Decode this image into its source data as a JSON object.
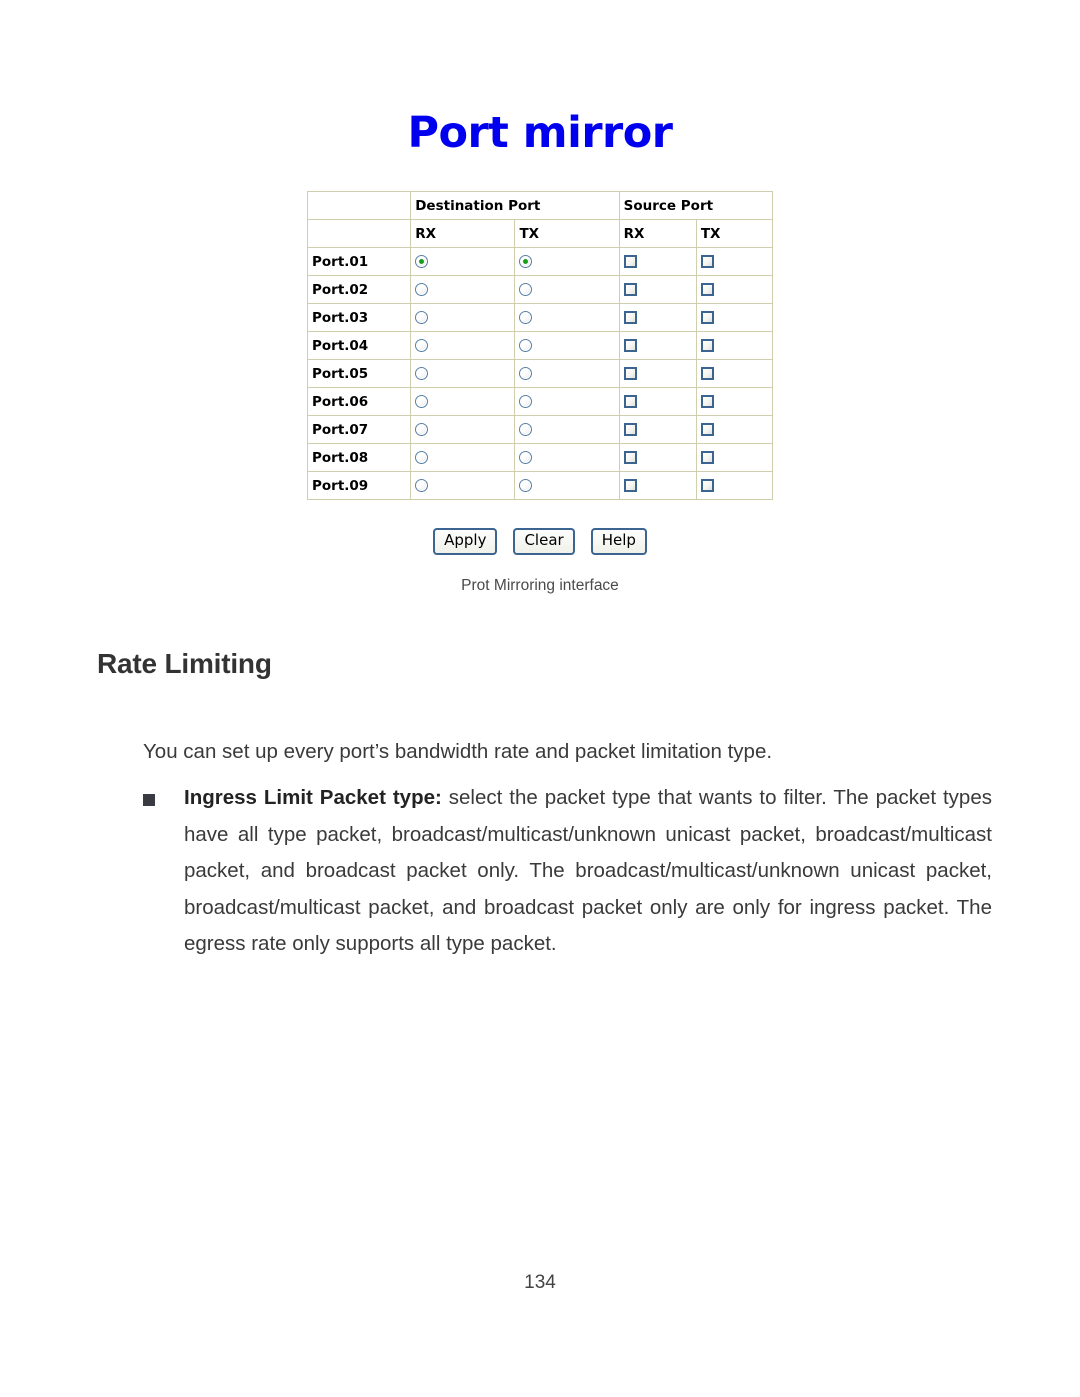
{
  "screenshot": {
    "title": "Port mirror",
    "title_color": "#0000ee",
    "table": {
      "group_headers": {
        "blank": "",
        "destination": "Destination Port",
        "source": "Source Port"
      },
      "sub_headers": {
        "dest_rx": "RX",
        "dest_tx": "TX",
        "src_rx": "RX",
        "src_tx": "TX"
      },
      "rows": [
        {
          "port": "Port.01",
          "dest_rx": true,
          "dest_tx": true,
          "src_rx": false,
          "src_tx": false
        },
        {
          "port": "Port.02",
          "dest_rx": false,
          "dest_tx": false,
          "src_rx": false,
          "src_tx": false
        },
        {
          "port": "Port.03",
          "dest_rx": false,
          "dest_tx": false,
          "src_rx": false,
          "src_tx": false
        },
        {
          "port": "Port.04",
          "dest_rx": false,
          "dest_tx": false,
          "src_rx": false,
          "src_tx": false
        },
        {
          "port": "Port.05",
          "dest_rx": false,
          "dest_tx": false,
          "src_rx": false,
          "src_tx": false
        },
        {
          "port": "Port.06",
          "dest_rx": false,
          "dest_tx": false,
          "src_rx": false,
          "src_tx": false
        },
        {
          "port": "Port.07",
          "dest_rx": false,
          "dest_tx": false,
          "src_rx": false,
          "src_tx": false
        },
        {
          "port": "Port.08",
          "dest_rx": false,
          "dest_tx": false,
          "src_rx": false,
          "src_tx": false
        },
        {
          "port": "Port.09",
          "dest_rx": false,
          "dest_tx": false,
          "src_rx": false,
          "src_tx": false
        }
      ]
    },
    "buttons": {
      "apply": "Apply",
      "clear": "Clear",
      "help": "Help"
    },
    "caption": "Prot Mirroring interface"
  },
  "document": {
    "heading": "Rate Limiting",
    "lead_paragraph": "You can set up every port’s bandwidth rate and packet limitation type.",
    "bullet": {
      "term": "Ingress Limit Packet type:",
      "description": " select the packet type that wants to filter. The packet types have all type packet, broadcast/multicast/unknown unicast packet, broadcast/multicast packet, and broadcast packet only. The broadcast/multicast/unknown unicast packet, broadcast/multicast packet, and broadcast packet only are only for ingress packet. The egress rate only supports all type packet."
    },
    "page_number": "134"
  }
}
